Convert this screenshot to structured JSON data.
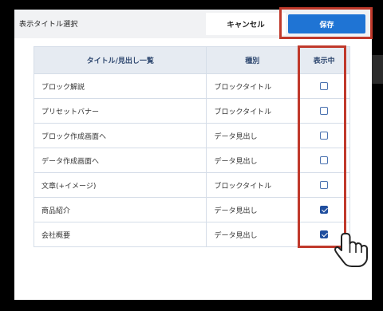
{
  "dialog": {
    "title": "表示タイトル選択",
    "cancel_label": "キャンセル",
    "save_label": "保存"
  },
  "colors": {
    "accent": "#1f74d4",
    "highlight": "#c0392b",
    "header_bg": "#e6ebf2",
    "checked": "#1f4e9e"
  },
  "table": {
    "headers": [
      "タイトル/見出し一覧",
      "種別",
      "表示中"
    ],
    "rows": [
      {
        "title": "ブロック解説",
        "type": "ブロックタイトル",
        "shown": false
      },
      {
        "title": "プリセットバナー",
        "type": "ブロックタイトル",
        "shown": false
      },
      {
        "title": "ブロック作成画面へ",
        "type": "データ見出し",
        "shown": false
      },
      {
        "title": "データ作成画面へ",
        "type": "データ見出し",
        "shown": false
      },
      {
        "title": "文章(+イメージ)",
        "type": "ブロックタイトル",
        "shown": false
      },
      {
        "title": "商品紹介",
        "type": "データ見出し",
        "shown": true
      },
      {
        "title": "会社概要",
        "type": "データ見出し",
        "shown": true
      }
    ]
  },
  "cursor": {
    "icon": "hand-pointer-icon"
  }
}
